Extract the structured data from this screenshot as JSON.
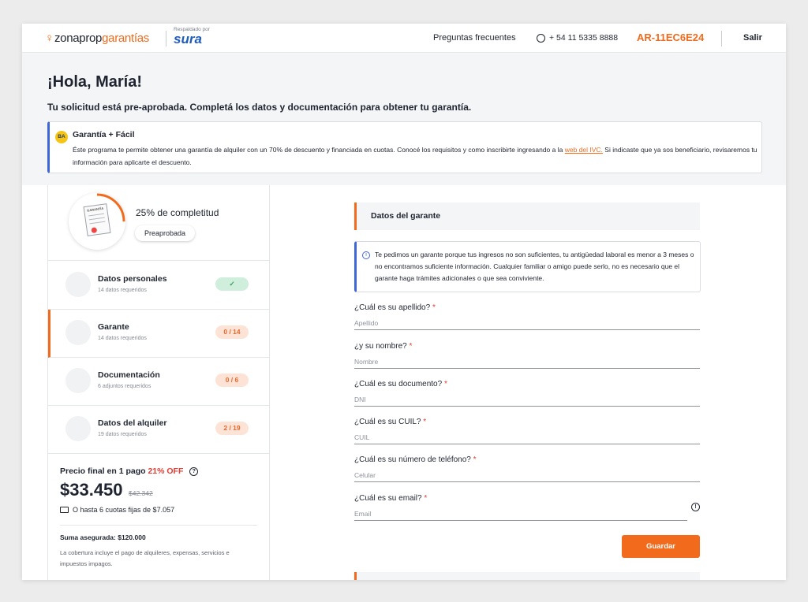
{
  "header": {
    "brand_prefix": "zonaprop",
    "brand_suffix": "garantías",
    "sura_tag": "Respaldado por",
    "sura_name": "sura",
    "faq": "Preguntas frecuentes",
    "phone": "+ 54 11 5335 8888",
    "code": "AR-11EC6E24",
    "logout": "Salir"
  },
  "greeting": {
    "title": "¡Hola, María!",
    "subtitle": "Tu solicitud está pre-aprobada. Completá los datos y documentación para obtener tu garantía."
  },
  "banner": {
    "logo_text": "BA",
    "title": "Garantía + Fácil",
    "text_before": "Éste programa te permite obtener una garantía de alquiler con un 70% de descuento y financiada en cuotas. Conocé los requisitos y como inscribirte ingresando a la ",
    "link": "web del IVC.",
    "text_after": " Si indicaste que ya sos beneficiario, revisaremos tu información para aplicarte el descuento."
  },
  "progress": {
    "percent_value": 25,
    "percent_label": "25% de completitud",
    "status": "Preaprobada",
    "doc_tag": "GARANTÍA"
  },
  "steps": [
    {
      "title": "Datos personales",
      "subtitle": "14 datos requeridos",
      "badge": "✓",
      "done": true,
      "active": false
    },
    {
      "title": "Garante",
      "subtitle": "14 datos requeridos",
      "badge": "0 / 14",
      "done": false,
      "active": true
    },
    {
      "title": "Documentación",
      "subtitle": "6 adjuntos requeridos",
      "badge": "0 / 6",
      "done": false,
      "active": false
    },
    {
      "title": "Datos del alquiler",
      "subtitle": "19 datos requeridos",
      "badge": "2 / 19",
      "done": false,
      "active": false
    }
  ],
  "price": {
    "title": "Precio final en 1 pago",
    "discount": "21% OFF",
    "help": "?",
    "amount": "$33.450",
    "old_amount": "$42.342",
    "installments": "O hasta 6 cuotas fijas de $7.057",
    "insured": "Suma asegurada: $120.000",
    "coverage": "La cobertura incluye el pago de alquileres, expensas, servicios e impuestos impagos."
  },
  "form": {
    "section_title": "Datos del garante",
    "info_icon": "i",
    "info_text": "Te pedimos un garante porque tus ingresos no son suficientes, tu antigüedad laboral es menor a 3 meses o no encontramos suficiente información. Cualquier familiar o amigo puede serlo, no es necesario que el garante haga trámites adicionales o que sea conviviente.",
    "required_mark": "*",
    "fields": [
      {
        "label": "¿Cuál es su apellido?",
        "placeholder": "Apellido",
        "value": ""
      },
      {
        "label": "¿y su nombre?",
        "placeholder": "Nombre",
        "value": ""
      },
      {
        "label": "¿Cuál es su documento?",
        "placeholder": "DNI",
        "value": ""
      },
      {
        "label": "¿Cuál es su CUIL?",
        "placeholder": "CUIL",
        "value": ""
      },
      {
        "label": "¿Cuál es su número de teléfono?",
        "placeholder": "Celular",
        "value": ""
      },
      {
        "label": "¿Cuál es su email?",
        "placeholder": "Email",
        "value": ""
      }
    ],
    "email_alert_icon": "!",
    "save": "Guardar"
  },
  "colors": {
    "accent": "#f26b1d",
    "info_border": "#3f66d6",
    "success_bg": "#cfeedc",
    "pending_bg": "#fde3d6",
    "discount": "#e03c35"
  },
  "icons": {
    "phone": "whatsapp-icon",
    "card": "credit-card-icon",
    "help": "question-circle-icon",
    "info": "info-circle-icon",
    "alert": "alert-circle-icon"
  }
}
